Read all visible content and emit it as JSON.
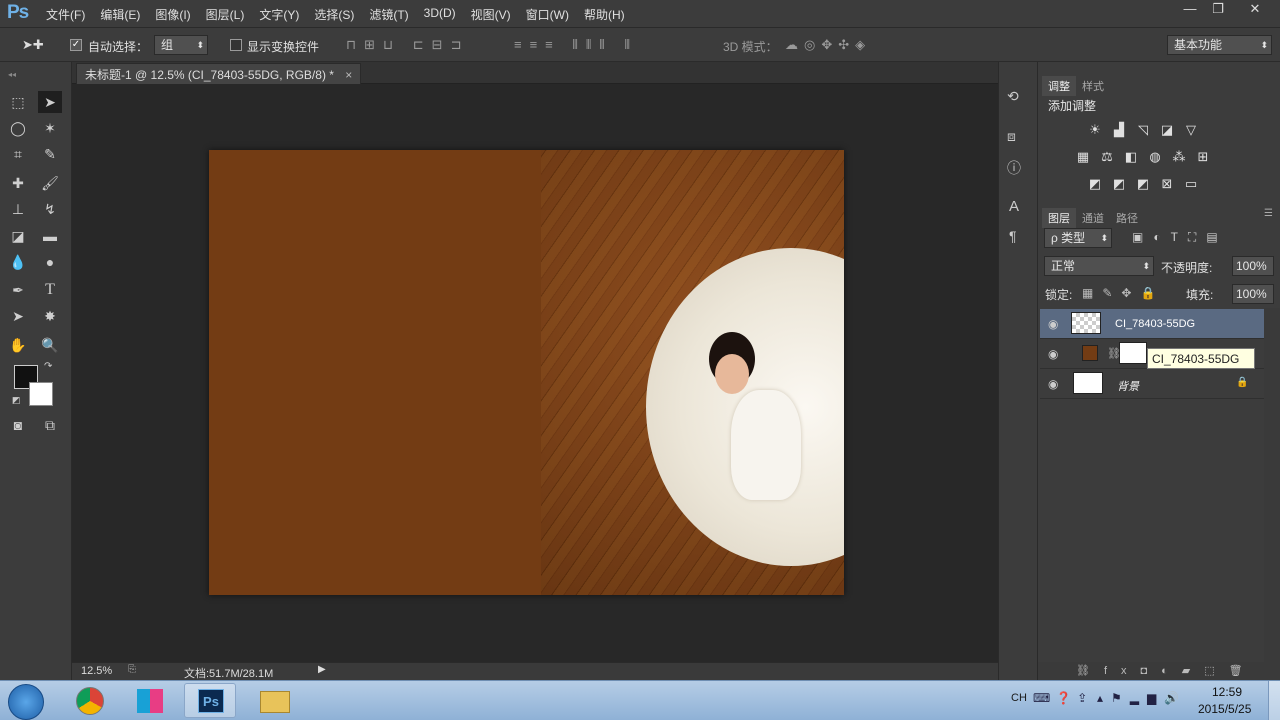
{
  "app": {
    "logo": "Ps"
  },
  "menu": [
    "文件(F)",
    "编辑(E)",
    "图像(I)",
    "图层(L)",
    "文字(Y)",
    "选择(S)",
    "滤镜(T)",
    "3D(D)",
    "视图(V)",
    "窗口(W)",
    "帮助(H)"
  ],
  "window_buttons": {
    "minimize": "—",
    "restore": "❐",
    "close": "✕"
  },
  "options": {
    "auto_select_label": "自动选择：",
    "auto_select_value": "组",
    "show_transform_label": "显示变换控件",
    "mode_3d_label": "3D 模式：",
    "workspace": "基本功能"
  },
  "document": {
    "tab_title": "未标题-1 @ 12.5% (CI_78403-55DG, RGB/8) *",
    "close": "×"
  },
  "status": {
    "zoom": "12.5%",
    "doc_size": "文档:51.7M/28.1M"
  },
  "adjust_panel": {
    "tabs": [
      "调整",
      "样式"
    ],
    "title": "添加调整"
  },
  "layers_panel": {
    "tabs": [
      "图层",
      "通道",
      "路径"
    ],
    "filter": "ρ 类型",
    "blend_mode": "正常",
    "opacity_label": "不透明度:",
    "opacity_value": "100%",
    "lock_label": "锁定:",
    "fill_label": "填充:",
    "fill_value": "100%",
    "layers": [
      {
        "name": "CI_78403-55DG"
      },
      {
        "name": ""
      },
      {
        "name": "背景"
      }
    ],
    "tooltip": "CI_78403-55DG"
  },
  "taskbar": {
    "lang": "CH",
    "time": "12:59",
    "date": "2015/5/25"
  },
  "colors": {
    "doc_fill": "#733c14",
    "selected_layer": "#5a6a82",
    "tooltip_bg": "#ffffe1"
  }
}
